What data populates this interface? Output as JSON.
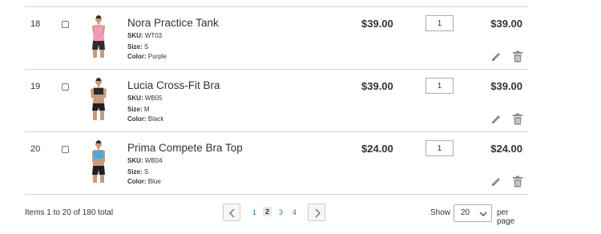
{
  "cart": {
    "rows": [
      {
        "index": "18",
        "name": "Nora Practice Tank",
        "sku_label": "SKU:",
        "sku": "WT03",
        "size_label": "Size:",
        "size": "S",
        "color_label": "Color:",
        "color": "Purple",
        "price": "$39.00",
        "qty": "1",
        "subtotal": "$39.00",
        "top_color": "#f39bb0",
        "bottom_color": "#2d2d2d"
      },
      {
        "index": "19",
        "name": "Lucia Cross-Fit Bra",
        "sku_label": "SKU:",
        "sku": "WB05",
        "size_label": "Size:",
        "size": "M",
        "color_label": "Color:",
        "color": "Black",
        "price": "$39.00",
        "qty": "1",
        "subtotal": "$39.00",
        "top_color": "#2a2a2a",
        "bottom_color": "#1e1e1e"
      },
      {
        "index": "20",
        "name": "Prima Compete Bra Top",
        "sku_label": "SKU:",
        "sku": "WB04",
        "size_label": "Size:",
        "size": "S",
        "color_label": "Color:",
        "color": "Blue",
        "price": "$24.00",
        "qty": "1",
        "subtotal": "$24.00",
        "top_color": "#4fa8dd",
        "bottom_color": "#1e1e1e"
      }
    ]
  },
  "footer": {
    "items_count": "Items 1 to 20 of 180 total",
    "pages": [
      "1",
      "2",
      "3",
      "4"
    ],
    "current_page": "2",
    "show_label": "Show",
    "per_page_value": "20",
    "per_page_suffix": "per page"
  },
  "colors": {
    "link": "#1979c3",
    "border": "#d1d1d1"
  },
  "icons": {
    "edit": "pencil-icon",
    "delete": "trash-icon",
    "prev": "chevron-left-icon",
    "next": "chevron-right-icon",
    "dropdown": "chevron-down-icon"
  }
}
